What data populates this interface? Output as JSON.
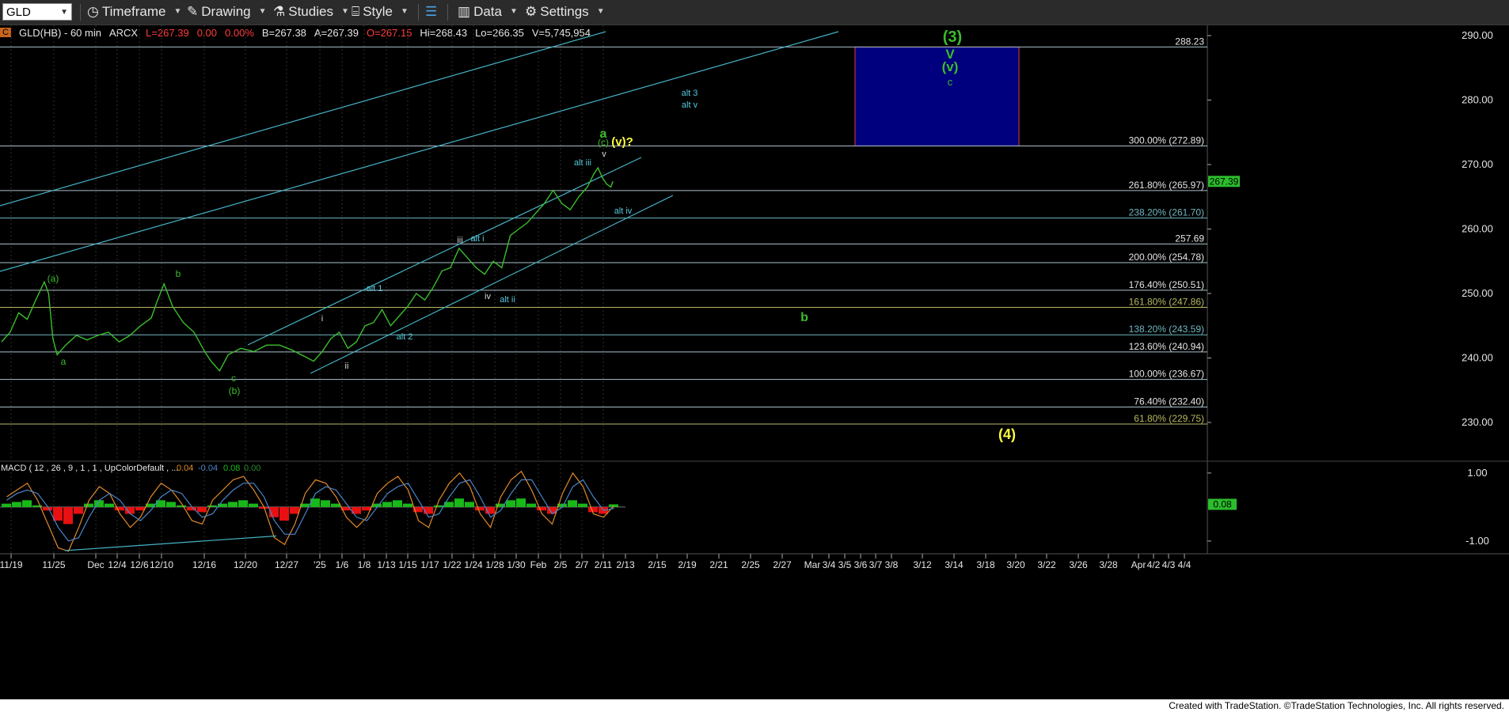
{
  "toolbar": {
    "symbol": "GLD",
    "items": [
      {
        "label": "Timeframe",
        "icon": "clock-icon"
      },
      {
        "label": "Drawing",
        "icon": "pencil-icon"
      },
      {
        "label": "Studies",
        "icon": "flask-icon"
      },
      {
        "label": "Style",
        "icon": "style-icon"
      },
      {
        "label": "Data",
        "icon": "bar-chart-icon"
      },
      {
        "label": "Settings",
        "icon": "gear-icon"
      }
    ]
  },
  "info_bar": {
    "badge": "C",
    "symbol_desc": "GLD(HB) - 60 min",
    "exchange": "ARCX",
    "last": "L=267.39",
    "change": "0.00",
    "change_pct": "0.00%",
    "bid": "B=267.38",
    "ask": "A=267.39",
    "open": "O=267.15",
    "high": "Hi=268.43",
    "low": "Lo=266.35",
    "volume": "V=5,745,954"
  },
  "footer": "Created with TradeStation. ©TradeStation Technologies, Inc. All rights reserved.",
  "colors": {
    "price": "#3bbd2c",
    "level_line": "#a9c0cc",
    "channel": "#46b3c6",
    "target_box": "#00007e",
    "wave_green": "#3bbd2c",
    "wave_yellow": "#ffff3a",
    "wave_cyan": "#56c9dc",
    "macd_pos": "#18b818",
    "macd_neg": "#e81010",
    "macd_line": "#e08a2a",
    "signal_line": "#4a84c8"
  },
  "chart_data": {
    "type": "line",
    "title": "GLD(HB) - 60 min",
    "ylabel": "",
    "ylim": [
      224.5,
      291.5
    ],
    "y_ticks": [
      "290.00",
      "280.00",
      "270.00",
      "260.00",
      "250.00",
      "240.00",
      "230.00"
    ],
    "last_price_tag": "267.39",
    "x_ticks": [
      "11/19",
      "11/25",
      "Dec",
      "12/4",
      "12/6",
      "12/10",
      "12/16",
      "12/20",
      "12/27",
      "'25",
      "1/6",
      "1/8",
      "1/13",
      "1/15",
      "1/17",
      "1/22",
      "1/24",
      "1/28",
      "1/30",
      "Feb",
      "2/5",
      "2/7",
      "2/11",
      "2/13",
      "2/15",
      "2/19",
      "2/21",
      "2/25",
      "2/27",
      "Mar",
      "3/4",
      "3/5",
      "3/6",
      "3/7",
      "3/8",
      "3/12",
      "3/14",
      "3/18",
      "3/20",
      "3/22",
      "3/26",
      "3/28",
      "Apr",
      "4/2",
      "4/3",
      "4/4"
    ],
    "series": [
      {
        "values": [
          [
            0,
            242.5
          ],
          [
            0.04,
            244
          ],
          [
            0.08,
            247
          ],
          [
            0.12,
            246
          ],
          [
            0.16,
            249
          ],
          [
            0.2,
            251.8
          ],
          [
            0.22,
            250
          ],
          [
            0.24,
            243
          ],
          [
            0.26,
            240.5
          ],
          [
            0.3,
            242
          ],
          [
            0.35,
            243.5
          ],
          [
            0.4,
            242.8
          ],
          [
            0.45,
            243.5
          ],
          [
            0.5,
            244
          ],
          [
            0.55,
            242.5
          ],
          [
            0.6,
            243.5
          ],
          [
            0.65,
            245
          ],
          [
            0.7,
            246.2
          ],
          [
            0.73,
            249
          ],
          [
            0.76,
            251.5
          ],
          [
            0.8,
            248
          ],
          [
            0.85,
            245.5
          ],
          [
            0.9,
            244
          ],
          [
            0.95,
            241
          ],
          [
            0.98,
            239.5
          ],
          [
            1.02,
            238
          ],
          [
            1.06,
            240.5
          ],
          [
            1.12,
            241.5
          ],
          [
            1.18,
            241
          ],
          [
            1.24,
            242
          ],
          [
            1.3,
            242
          ],
          [
            1.36,
            241.2
          ],
          [
            1.42,
            240.2
          ],
          [
            1.46,
            239.5
          ],
          [
            1.5,
            241
          ],
          [
            1.54,
            243
          ],
          [
            1.58,
            244
          ],
          [
            1.62,
            241.5
          ],
          [
            1.66,
            242.5
          ],
          [
            1.7,
            245
          ],
          [
            1.74,
            245.5
          ],
          [
            1.78,
            247.5
          ],
          [
            1.82,
            245
          ],
          [
            1.86,
            246.5
          ],
          [
            1.9,
            248
          ],
          [
            1.94,
            250
          ],
          [
            1.98,
            249
          ],
          [
            2.02,
            251
          ],
          [
            2.06,
            253.5
          ],
          [
            2.1,
            254
          ],
          [
            2.14,
            257
          ],
          [
            2.18,
            255.5
          ],
          [
            2.22,
            254
          ],
          [
            2.26,
            253
          ],
          [
            2.3,
            255
          ],
          [
            2.34,
            254
          ],
          [
            2.38,
            259
          ],
          [
            2.42,
            260
          ],
          [
            2.46,
            261
          ],
          [
            2.5,
            262.5
          ],
          [
            2.54,
            264
          ],
          [
            2.58,
            266
          ],
          [
            2.62,
            264
          ],
          [
            2.66,
            263
          ],
          [
            2.7,
            265
          ],
          [
            2.74,
            266.5
          ],
          [
            2.77,
            268.5
          ],
          [
            2.79,
            269.5
          ],
          [
            2.81,
            268
          ],
          [
            2.83,
            267
          ],
          [
            2.85,
            266.5
          ],
          [
            2.86,
            267.4
          ]
        ]
      }
    ],
    "fib_levels": [
      {
        "label": "288.23",
        "value": 288.23
      },
      {
        "label": "300.00% (272.89)",
        "value": 272.89
      },
      {
        "label": "261.80% (265.97)",
        "value": 265.97
      },
      {
        "label": "238.20% (261.70)",
        "value": 261.7
      },
      {
        "label": "257.69",
        "value": 257.69
      },
      {
        "label": "200.00% (254.78)",
        "value": 254.78
      },
      {
        "label": "176.40% (250.51)",
        "value": 250.51
      },
      {
        "label": "161.80% (247.86)",
        "value": 247.86
      },
      {
        "label": "138.20% (243.59)",
        "value": 243.59
      },
      {
        "label": "123.60% (240.94)",
        "value": 240.94
      },
      {
        "label": "100.00% (236.67)",
        "value": 236.67
      },
      {
        "label": "76.40% (232.40)",
        "value": 232.4
      },
      {
        "label": "61.80% (229.75)",
        "value": 229.75
      }
    ],
    "target_box": {
      "y_top": 288.23,
      "y_bottom": 272.89
    },
    "wave_labels": [
      {
        "text": "(3)",
        "color": "green",
        "size": 20
      },
      {
        "text": "V",
        "color": "green",
        "size": 17
      },
      {
        "text": "(v)",
        "color": "green",
        "size": 17
      },
      {
        "text": "c",
        "color": "green",
        "size": 13
      },
      {
        "text": "alt 3",
        "color": "cyan",
        "size": 11
      },
      {
        "text": "alt v",
        "color": "cyan",
        "size": 11
      },
      {
        "text": "a",
        "color": "green",
        "size": 16
      },
      {
        "text": "(c)",
        "color": "green",
        "size": 12
      },
      {
        "text": "(v)?",
        "color": "yellow",
        "size": 15
      },
      {
        "text": "v",
        "color": "white",
        "size": 11
      },
      {
        "text": "alt iii",
        "color": "cyan",
        "size": 11
      },
      {
        "text": "alt iv",
        "color": "cyan",
        "size": 11
      },
      {
        "text": "iii",
        "color": "white",
        "size": 11
      },
      {
        "text": "alt i",
        "color": "cyan",
        "size": 11
      },
      {
        "text": "alt 1",
        "color": "cyan",
        "size": 11
      },
      {
        "text": "iv",
        "color": "white",
        "size": 11
      },
      {
        "text": "alt ii",
        "color": "cyan",
        "size": 11
      },
      {
        "text": "i",
        "color": "white",
        "size": 11
      },
      {
        "text": "alt 2",
        "color": "cyan",
        "size": 11
      },
      {
        "text": "ii",
        "color": "white",
        "size": 11
      },
      {
        "text": "(a)",
        "color": "green",
        "size": 12
      },
      {
        "text": "b",
        "color": "green",
        "size": 12
      },
      {
        "text": "a",
        "color": "green",
        "size": 12
      },
      {
        "text": "c",
        "color": "green",
        "size": 12
      },
      {
        "text": "(b)",
        "color": "green",
        "size": 12
      },
      {
        "text": "b",
        "color": "green",
        "size": 16
      },
      {
        "text": "(4)",
        "color": "yellow",
        "size": 18
      }
    ],
    "macd": {
      "label": "MACD ( 12 , 26 , 9 , 1 , 1 , UpColorDefault , ...",
      "values": [
        "0.04",
        "-0.04",
        "0.08",
        "0.00"
      ],
      "ylim": [
        -1.35,
        1.3
      ],
      "y_ticks": [
        "1.00",
        "-1.00"
      ],
      "last_tag": "0.08",
      "hist": [
        0.1,
        0.15,
        0.2,
        0.05,
        -0.1,
        -0.4,
        -0.5,
        -0.2,
        0.1,
        0.2,
        0.1,
        -0.1,
        -0.2,
        -0.1,
        0.1,
        0.2,
        0.15,
        0.05,
        -0.1,
        -0.15,
        0.05,
        0.1,
        0.15,
        0.2,
        0.1,
        -0.05,
        -0.3,
        -0.4,
        -0.2,
        0.1,
        0.25,
        0.2,
        0.1,
        -0.1,
        -0.2,
        -0.1,
        0.1,
        0.15,
        0.2,
        0.1,
        -0.15,
        -0.2,
        0.05,
        0.15,
        0.25,
        0.15,
        -0.1,
        -0.2,
        0.1,
        0.2,
        0.25,
        0.1,
        -0.1,
        -0.2,
        0.1,
        0.2,
        0.1,
        -0.15,
        -0.2,
        0.08
      ],
      "macd_line": [
        0.3,
        0.5,
        0.7,
        0.2,
        -0.5,
        -1.2,
        -1.3,
        -0.6,
        0.2,
        0.6,
        0.4,
        -0.2,
        -0.6,
        -0.3,
        0.3,
        0.7,
        0.5,
        0.1,
        -0.4,
        -0.5,
        0.2,
        0.5,
        0.8,
        0.9,
        0.5,
        0,
        -0.9,
        -1.1,
        -0.5,
        0.4,
        0.8,
        0.7,
        0.3,
        -0.3,
        -0.6,
        -0.3,
        0.4,
        0.7,
        0.9,
        0.5,
        -0.4,
        -0.6,
        0.2,
        0.7,
        1.0,
        0.6,
        -0.2,
        -0.6,
        0.3,
        0.8,
        1.05,
        0.5,
        -0.2,
        -0.5,
        0.4,
        1.0,
        0.6,
        -0.2,
        -0.3,
        0.04
      ],
      "signal_line": [
        0.2,
        0.4,
        0.5,
        0.4,
        0,
        -0.6,
        -1.0,
        -0.9,
        -0.3,
        0.2,
        0.4,
        0.2,
        -0.2,
        -0.4,
        -0.1,
        0.3,
        0.5,
        0.4,
        0,
        -0.3,
        -0.2,
        0.2,
        0.5,
        0.7,
        0.7,
        0.3,
        -0.4,
        -0.8,
        -0.8,
        -0.2,
        0.4,
        0.6,
        0.5,
        0.1,
        -0.3,
        -0.4,
        0,
        0.4,
        0.6,
        0.7,
        0.2,
        -0.3,
        -0.2,
        0.3,
        0.7,
        0.8,
        0.3,
        -0.3,
        -0.1,
        0.4,
        0.8,
        0.8,
        0.3,
        -0.2,
        0,
        0.6,
        0.8,
        0.3,
        -0.1,
        -0.04
      ]
    }
  }
}
